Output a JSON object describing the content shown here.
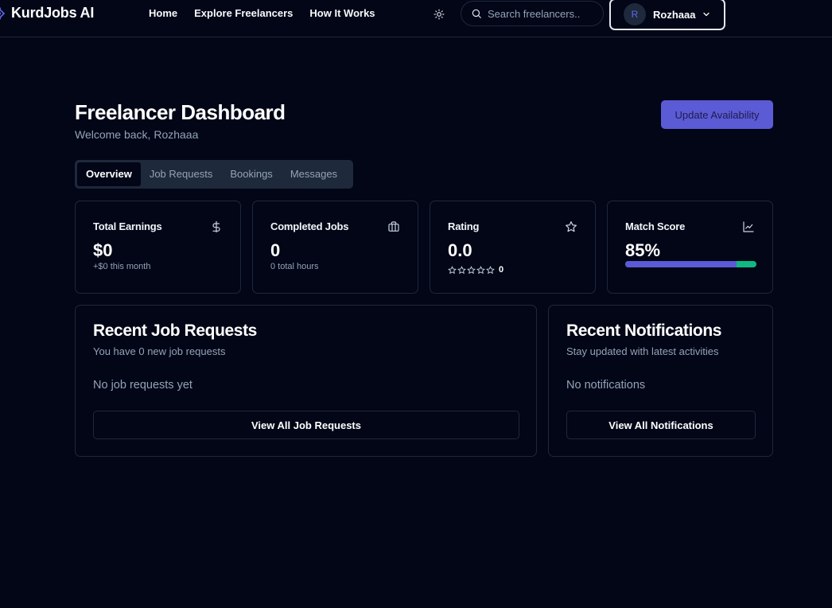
{
  "nav": {
    "brand": "KurdJobs AI",
    "links": [
      "Home",
      "Explore Freelancers",
      "How It Works"
    ],
    "search_placeholder": "Search freelancers..",
    "user": {
      "initial": "R",
      "name": "Rozhaaa"
    }
  },
  "header": {
    "title": "Freelancer Dashboard",
    "subtitle": "Welcome back, Rozhaaa",
    "action_label": "Update Availability"
  },
  "tabs": [
    {
      "label": "Overview",
      "active": true
    },
    {
      "label": "Job Requests",
      "active": false
    },
    {
      "label": "Bookings",
      "active": false
    },
    {
      "label": "Messages",
      "active": false
    }
  ],
  "stats": {
    "earnings": {
      "label": "Total Earnings",
      "value": "$0",
      "sub": "+$0 this month",
      "icon": "dollar-icon"
    },
    "completed": {
      "label": "Completed Jobs",
      "value": "0",
      "sub": "0 total hours",
      "icon": "briefcase-icon"
    },
    "rating": {
      "label": "Rating",
      "value": "0.0",
      "stars_filled": 0,
      "stars_total": 5,
      "review_count": "0",
      "icon": "star-icon"
    },
    "match": {
      "label": "Match Score",
      "value": "85%",
      "progress": 0.85,
      "icon": "chart-line-icon"
    }
  },
  "job_requests": {
    "title": "Recent Job Requests",
    "subtitle": "You have 0 new job requests",
    "empty": "No job requests yet",
    "button": "View All Job Requests"
  },
  "notifications": {
    "title": "Recent Notifications",
    "subtitle": "Stay updated with latest activities",
    "empty": "No notifications",
    "button": "View All Notifications"
  },
  "colors": {
    "background": "#020617",
    "border": "#1e293b",
    "accent": "#5b5bd6",
    "success": "#10b981",
    "muted_text": "#94a3b8"
  }
}
